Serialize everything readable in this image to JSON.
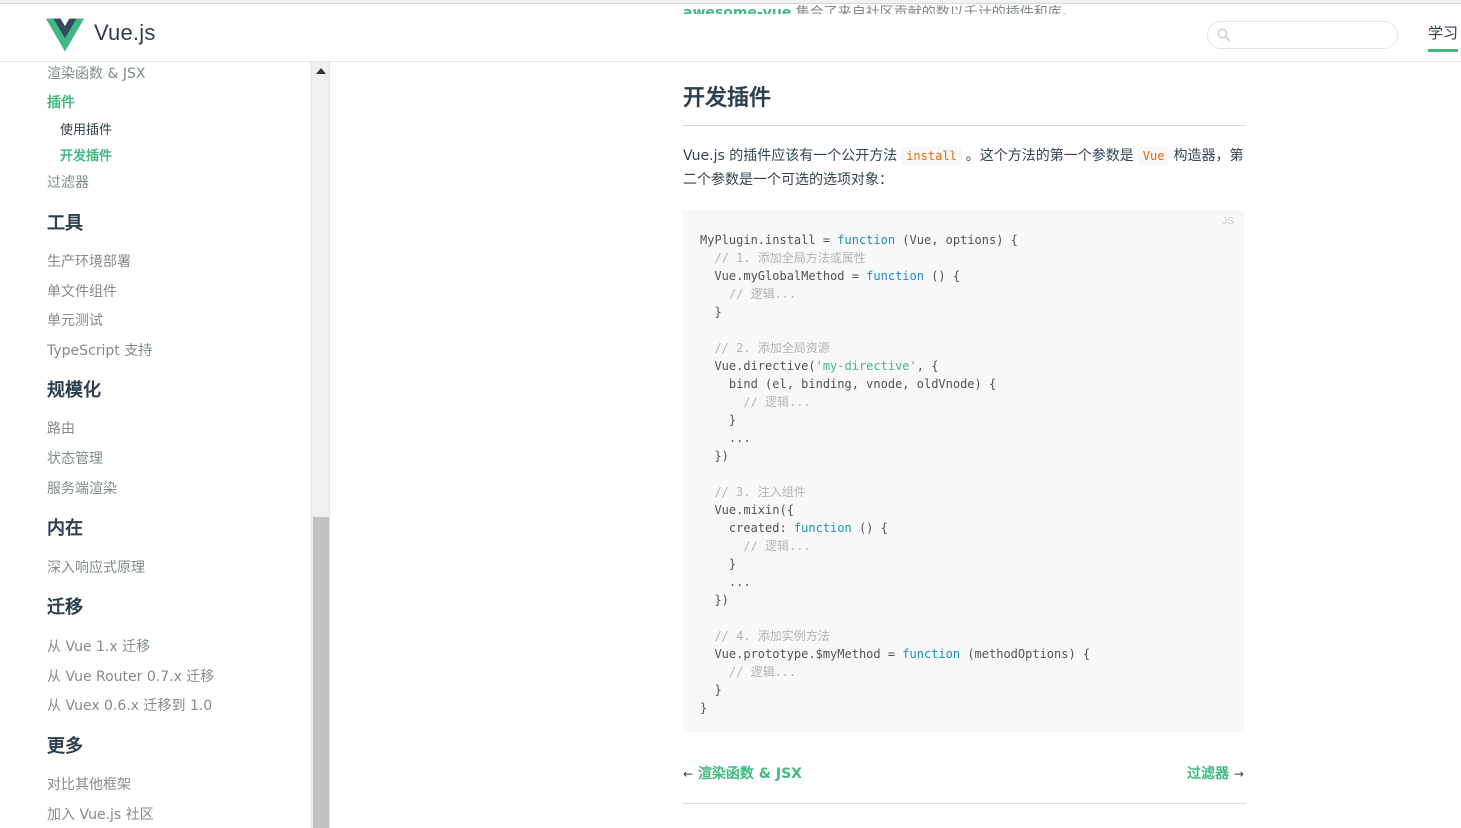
{
  "header": {
    "brand": "Vue.js",
    "cutoff_link": "awesome-vue",
    "cutoff_text": " 集合了来自社区贡献的数以千计的插件和库。",
    "search_placeholder": "",
    "nav_learn": "学习"
  },
  "sidebar": {
    "render_jsx": "渲染函数 & JSX",
    "plugins": "插件",
    "using_plugins": "使用插件",
    "writing_plugins": "开发插件",
    "filters": "过滤器",
    "tooling_head": "工具",
    "deployment": "生产环境部署",
    "sfc": "单文件组件",
    "unit_testing": "单元测试",
    "typescript": "TypeScript 支持",
    "scaling_head": "规模化",
    "routing": "路由",
    "state": "状态管理",
    "ssr": "服务端渲染",
    "internals_head": "内在",
    "reactivity": "深入响应式原理",
    "migration_head": "迁移",
    "migration_vue": "从 Vue 1.x 迁移",
    "migration_router": "从 Vue Router 0.7.x 迁移",
    "migration_vuex": "从 Vuex 0.6.x 迁移到 1.0",
    "meta_head": "更多",
    "comparison": "对比其他框架",
    "join": "加入 Vue.js 社区"
  },
  "content": {
    "heading": "开发插件",
    "para_1": "Vue.js 的插件应该有一个公开方法",
    "code_install": "install",
    "para_2": "。这个方法的第一个参数是",
    "code_vue": "Vue",
    "para_3": "构造器，第二个参数是一个可选的选项对象：",
    "code_lang": "JS",
    "prev_label": "渲染函数 & JSX",
    "next_label": "过滤器"
  },
  "icons": {
    "search": "search-icon",
    "logo": "vue-logo-icon",
    "scroll_up": "scroll-up-arrow-icon"
  },
  "colors": {
    "accent": "#42b983",
    "text": "#2c3e50",
    "keyword": "#1990b8",
    "code_inline": "#e96900"
  }
}
